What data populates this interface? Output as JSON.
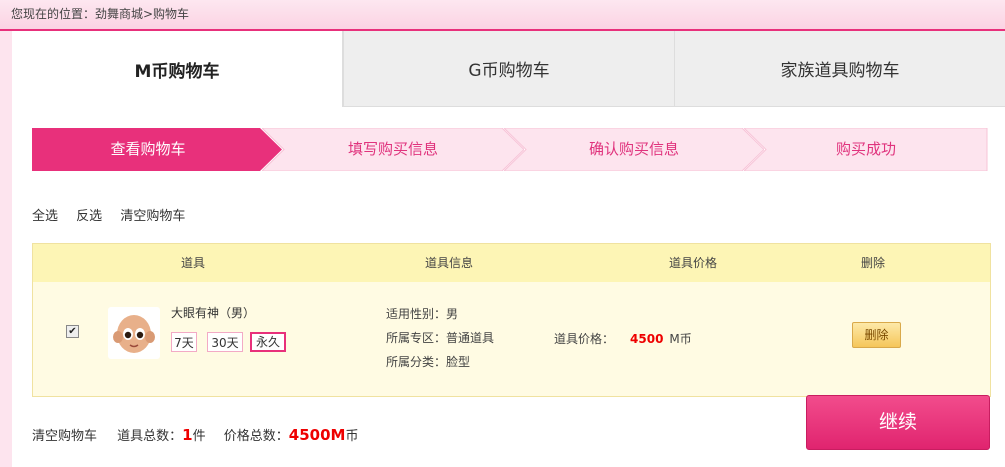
{
  "breadcrumb": "您现在的位置：劲舞商城>购物车",
  "tabs": [
    {
      "label": "M币购物车",
      "active": true
    },
    {
      "label": "G币购物车",
      "active": false
    },
    {
      "label": "家族道具购物车",
      "active": false
    }
  ],
  "steps": [
    {
      "label": "查看购物车",
      "active": true
    },
    {
      "label": "填写购买信息",
      "active": false
    },
    {
      "label": "确认购买信息",
      "active": false
    },
    {
      "label": "购买成功",
      "active": false
    }
  ],
  "actions": {
    "select_all": "全选",
    "invert": "反选",
    "clear": "清空购物车"
  },
  "table": {
    "headers": {
      "item": "道具",
      "info": "道具信息",
      "price": "道具价格",
      "delete": "删除"
    },
    "rows": [
      {
        "checked": true,
        "name": "大眼有神（男）",
        "durations": [
          "7天",
          "30天",
          "永久"
        ],
        "selected_duration": "永久",
        "info": [
          "适用性别：男",
          "所属专区：普通道具",
          "所属分类：脸型"
        ],
        "price_label": "道具价格：",
        "price_value": "4500",
        "price_unit": "M币",
        "delete_label": "删除"
      }
    ]
  },
  "summary": {
    "clear": "清空购物车",
    "count_label": "道具总数：",
    "count_value": "1",
    "count_unit": "件",
    "total_label": "价格总数：",
    "total_value": "4500M",
    "total_unit": "币"
  },
  "continue_label": "继续",
  "colors": {
    "accent": "#e8307b",
    "step_inactive_bg": "#fde4ee",
    "table_header": "#fdf5b5",
    "price": "#ee0000"
  }
}
